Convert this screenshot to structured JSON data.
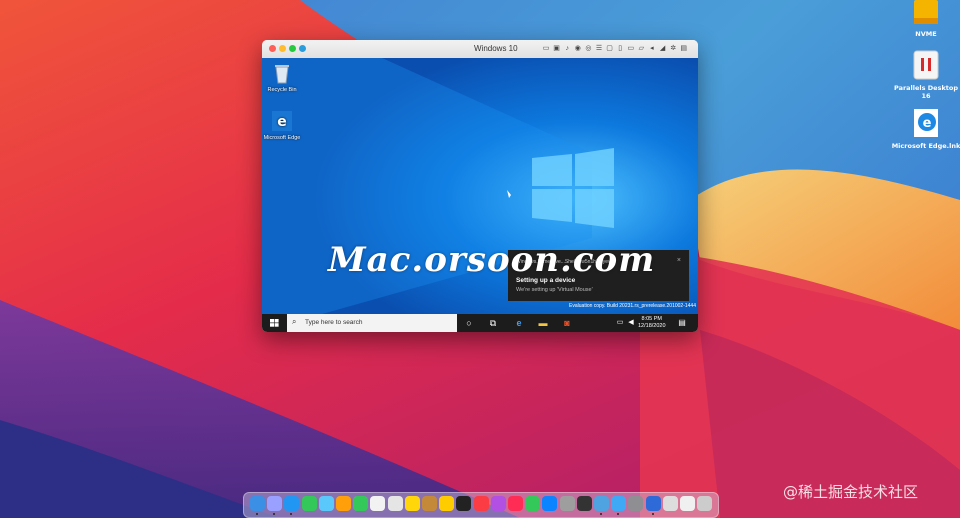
{
  "desktop": {
    "icons": [
      {
        "label": "NVME",
        "icon": "drive-icon"
      },
      {
        "label": "Parallels Desktop 16",
        "icon": "parallels-icon"
      },
      {
        "label": "Microsoft Edge.lnk",
        "icon": "edge-icon"
      }
    ]
  },
  "vm": {
    "title": "Windows 10",
    "toolbar_icons": [
      "keyboard-icon",
      "chip-icon",
      "mic-icon",
      "camera-icon",
      "eye-icon",
      "wifi-icon",
      "display-icon",
      "phone-icon",
      "tablet-icon",
      "folder-icon",
      "share-icon",
      "volume-icon",
      "gear-icon",
      "sidebar-icon"
    ],
    "win_icons": [
      {
        "label": "Recycle Bin",
        "icon": "recycle-bin-icon"
      },
      {
        "label": "Microsoft Edge",
        "icon": "edge-icon"
      }
    ],
    "toast": {
      "header": "Windows.Immersive...Shell_cw5n1h2txyew...",
      "title": "Setting up a device",
      "body": "We're setting up 'Virtual Mouse'",
      "close": "×"
    },
    "eval_text": "Evaluation copy. Build 20231.rs_prerelease.201002-1444",
    "taskbar": {
      "search_placeholder": "Type here to search",
      "time": "8:05 PM",
      "date": "12/18/2020"
    }
  },
  "watermark": "Mac.orsoon.com",
  "corner_watermark": "@稀土掘金技术社区",
  "colors": {
    "win_blue": "#0a62c8",
    "taskbar": "#1c1c1c"
  }
}
